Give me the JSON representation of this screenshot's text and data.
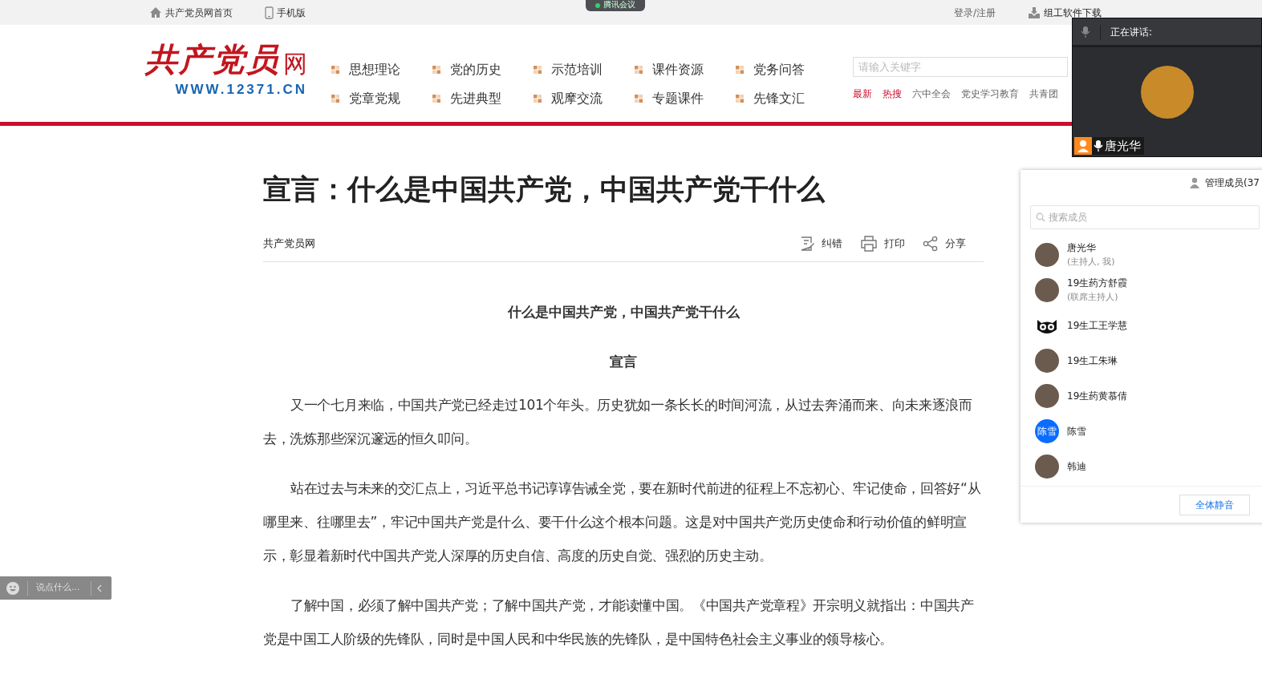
{
  "top_bar": {
    "left": [
      {
        "text": "共产党员网首页",
        "kind": "home"
      },
      {
        "text": "手机版",
        "kind": "mobile"
      }
    ],
    "right": [
      {
        "text": "登录/注册",
        "kind": "plain"
      },
      {
        "text": "组工软件下载",
        "kind": "download"
      }
    ]
  },
  "meeting_tab": {
    "title": "腾讯会议"
  },
  "logo": {
    "title": "共产党员",
    "suffix": "网",
    "url": "WWW.12371.CN"
  },
  "nav": [
    [
      "思想理论",
      "党的历史",
      "示范培训",
      "课件资源",
      "党务问答"
    ],
    [
      "党章党规",
      "先进典型",
      "观摩交流",
      "专题课件",
      "先锋文汇"
    ]
  ],
  "search": {
    "placeholder": "请输入关键字"
  },
  "hot_tags": [
    {
      "text": "最新",
      "highlight": true
    },
    {
      "text": "热搜",
      "highlight": true
    },
    {
      "text": "六中全会",
      "highlight": false
    },
    {
      "text": "党史学习教育",
      "highlight": false
    },
    {
      "text": "共青团",
      "highlight": false
    }
  ],
  "article": {
    "title": "宣言：什么是中国共产党，中国共产党干什么",
    "source": "共产党员网",
    "actions": [
      {
        "label": "纠错",
        "kind": "edit"
      },
      {
        "label": "打印",
        "kind": "print"
      },
      {
        "label": "分享",
        "kind": "share"
      }
    ],
    "subtitle": "什么是中国共产党，中国共产党干什么",
    "heading": "宣言",
    "paragraphs": [
      "又一个七月来临，中国共产党已经走过101个年头。历史犹如一条长长的时间河流，从过去奔涌而来、向未来逐浪而去，洗炼那些深沉邃远的恒久叩问。",
      "站在过去与未来的交汇点上，习近平总书记谆谆告诫全党，要在新时代前进的征程上不忘初心、牢记使命，回答好“从哪里来、往哪里去”，牢记中国共产党是什么、要干什么这个根本问题。这是对中国共产党历史使命和行动价值的鲜明宣示，彰显着新时代中国共产党人深厚的历史自信、高度的历史自觉、强烈的历史主动。",
      "了解中国，必须了解中国共产党；了解中国共产党，才能读懂中国。《中国共产党章程》开宗明义就指出：中国共产党是中国工人阶级的先锋队，同时是中国人民和中华民族的先锋队，是中国特色社会主义事业的领导核心。"
    ]
  },
  "speaker_panel": {
    "label": "正在讲话:",
    "name": "唐光华"
  },
  "members_panel": {
    "title": "管理成员(37",
    "search_placeholder": "搜索成员",
    "members": [
      {
        "name": "唐光华",
        "role": "(主持人, 我)",
        "kind": "photo"
      },
      {
        "name": "19生药方舒霞",
        "role": "(联席主持人)",
        "kind": "photo"
      },
      {
        "name": "19生工王学慧",
        "kind": "cat"
      },
      {
        "name": "19生工朱琳",
        "kind": "photo"
      },
      {
        "name": "19生药黄慕倩",
        "kind": "photo"
      },
      {
        "name": "陈雪",
        "kind": "text",
        "avatar_text": "陈雪"
      },
      {
        "name": "韩迪",
        "kind": "photo"
      }
    ],
    "button": "全体静音"
  },
  "chat_bar": {
    "placeholder": "说点什么..."
  }
}
